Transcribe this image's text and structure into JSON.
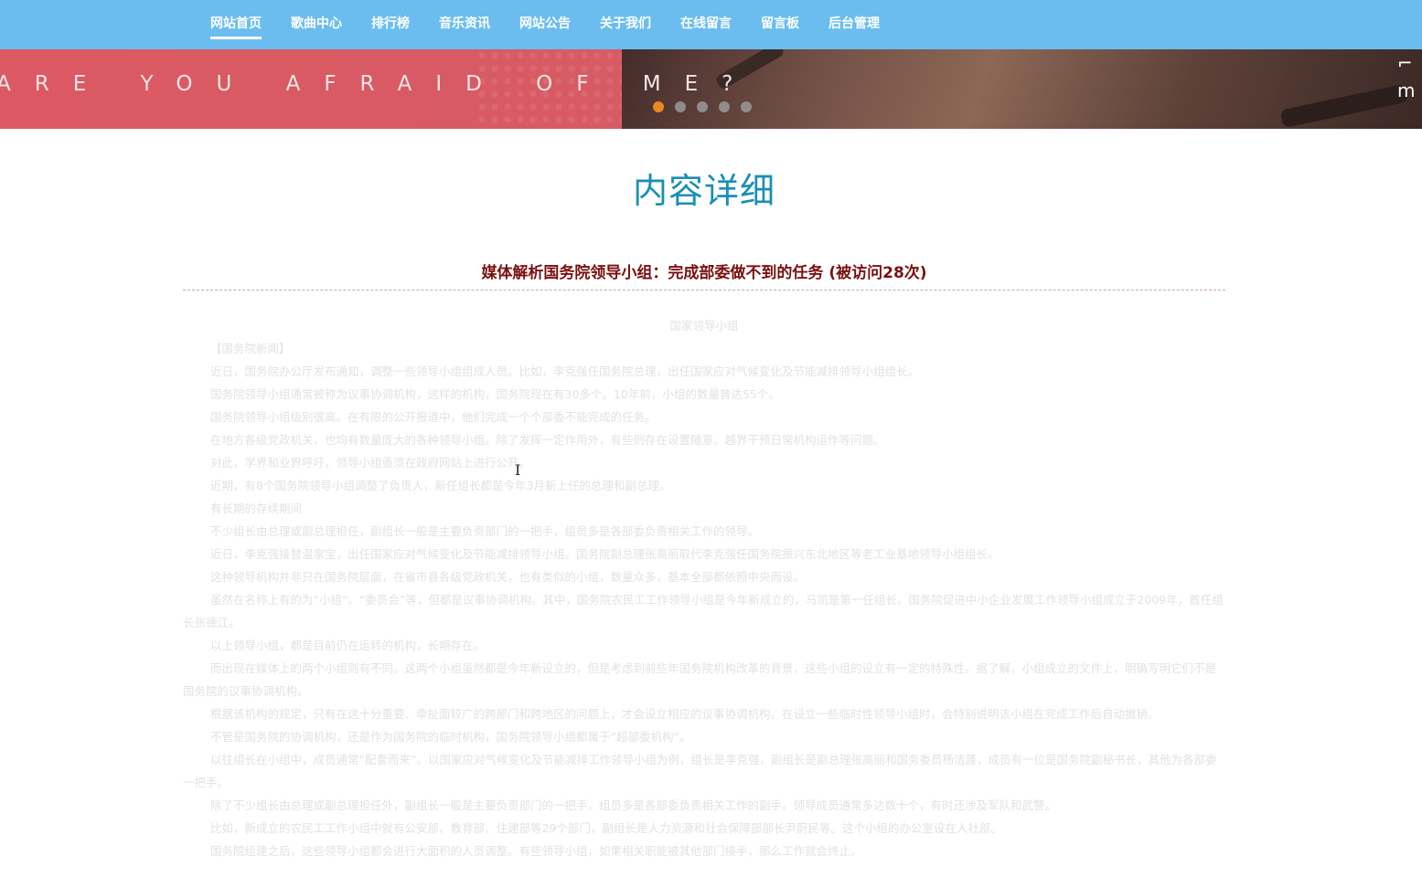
{
  "nav": {
    "items": [
      {
        "label": "网站首页",
        "active": true
      },
      {
        "label": "歌曲中心"
      },
      {
        "label": "排行榜"
      },
      {
        "label": "音乐资讯"
      },
      {
        "label": "网站公告"
      },
      {
        "label": "关于我们"
      },
      {
        "label": "在线留言"
      },
      {
        "label": "留言板"
      },
      {
        "label": "后台管理"
      }
    ]
  },
  "banner": {
    "slogan": "ARE YOU AFRAID OF ME?",
    "slide_count": 5,
    "active_slide": 1
  },
  "page": {
    "title": "内容详细"
  },
  "article": {
    "title": "媒体解析国务院领导小组：完成部委做不到的任务 (被访问28次)",
    "image_caption": "国家领导小组",
    "paragraphs": [
      "【国务院新闻】",
      "近日，国务院办公厅发布通知，调整一些领导小组组成人员。比如，李克强任国务院总理，出任国家应对气候变化及节能减排领导小组组长。",
      "国务院领导小组通常被称为议事协调机构，这样的机构，国务院现在有30多个。10年前，小组的数量曾达55个。",
      "国务院领导小组级别很高。在有限的公开报道中，他们完成一个个部委不能完成的任务。",
      "在地方各级党政机关，也均有数量庞大的各种领导小组。除了发挥一定作用外，有些则存在设置随意、越界干预日常机构运作等问题。",
      "对此，学界和业界呼吁，领导小组亟须在政府网站上进行公开。",
      "近期，有8个国务院领导小组调整了负责人，新任组长都是今年3月新上任的总理和副总理。",
      "有长期的存续期间",
      "不少组长由总理或副总理担任，副组长一般是主要负责部门的一把手，组员多是各部委负责相关工作的领导。",
      "近日，李克强接替温家宝，出任国家应对气候变化及节能减排领导小组。国务院副总理张高丽取代李克强任国务院振兴东北地区等老工业基地领导小组组长。",
      "这种领导机构并非只在国务院层面，在省市县各级党政机关，也有类似的小组，数量众多，基本全部都依照中央而设。",
      "虽然在名称上有的为“小组”、“委员会”等，但都是议事协调机构。其中，国务院农民工工作领导小组是今年新成立的，马凯是第一任组长。国务院促进中小企业发展工作领导小组成立于2009年，首任组长张德江。",
      "以上领导小组，都是目前仍在运转的机构，长期存在。",
      "而出现在媒体上的两个小组则有不同。这两个小组虽然都是今年新设立的，但是考虑到前些年国务院机构改革的背景，这些小组的设立有一定的特殊性。据了解，小组成立的文件上，明确写明它们不是国务院的议事协调机构。",
      "根据该机构的规定，只有在这十分重要、牵扯面较广的跨部门和跨地区的问题上，才会设立相应的议事协调机构。在设立一些临时性领导小组时，会特别说明该小组在完成工作后自动撤销。",
      "不管是国务院的协调机构，还是作为国务院的临时机构，国务院领导小组都属于“超部委机构”。",
      "以往组长在小组中，成员通常“配套而来”。以国家应对气候变化及节能减排工作领导小组为例，组长是李克强，副组长是副总理张高丽和国务委员杨洁篪，成员有一位是国务院副秘书长，其他为各部委一把手。",
      "除了不少组长由总理或副总理担任外，副组长一般是主要负责部门的一把手，组员多是各部委负责相关工作的副手。领导成员通常多达数十个，有时还涉及军队和武警。",
      "比如，新成立的农民工工作小组中就有公安部、教育部、住建部等29个部门，副组长是人力资源和社会保障部部长尹蔚民等。这个小组的办公室设在人社部。",
      "国务院组建之后，这些领导小组都会进行大面积的人员调整。有些领导小组，如果相关职能被其他部门接手，那么工作就会终止。"
    ]
  },
  "colors": {
    "nav_bg": "#6bbdf0",
    "title_color": "#1a8fb4",
    "article_title_color": "#7a1010",
    "active_dot": "#e68a1f"
  }
}
